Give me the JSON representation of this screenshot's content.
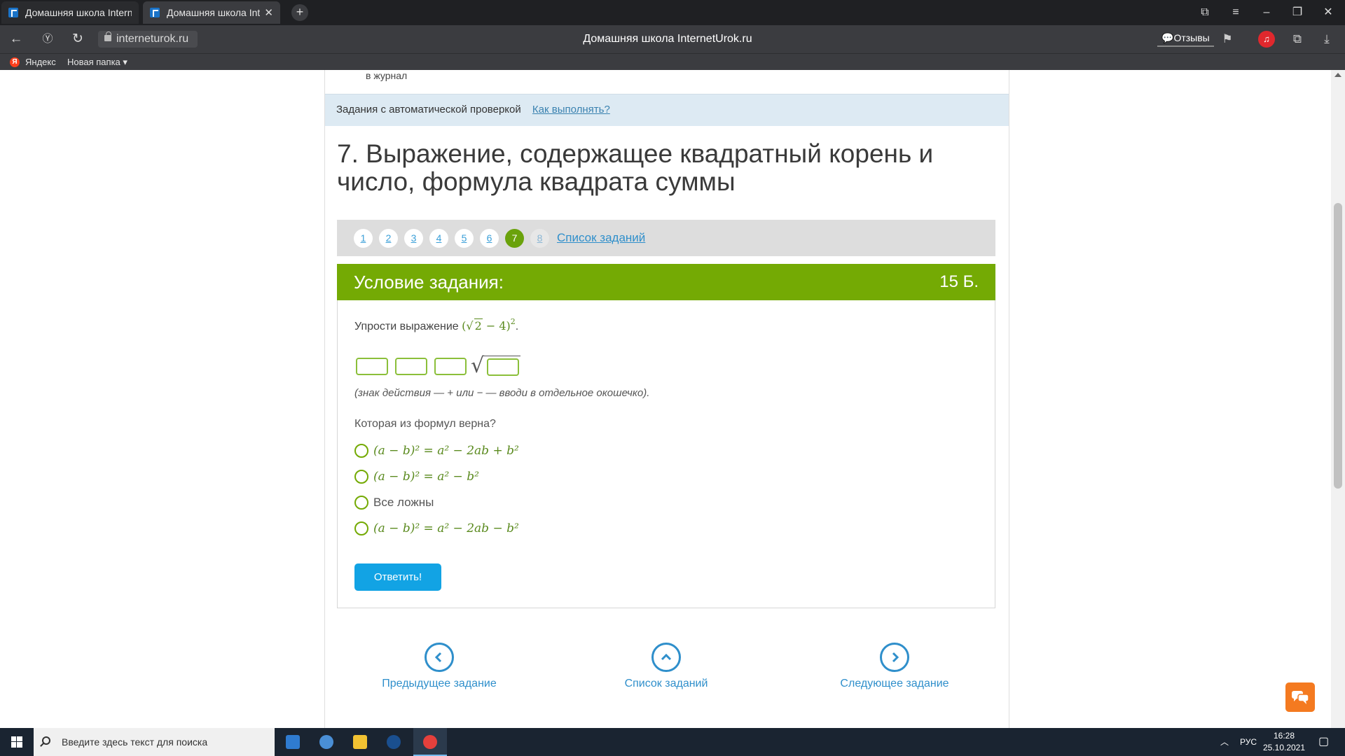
{
  "browser": {
    "tabs": [
      {
        "title": "Домашняя школа InternetUrok.ru"
      },
      {
        "title": "Домашняя школа InternetUrok.ru"
      }
    ],
    "url": "interneturok.ru",
    "page_title": "Домашняя школа InternetUrok.ru",
    "reviews_label": "Отзывы",
    "bookmarks": [
      {
        "label": "Яндекс"
      },
      {
        "label": "Новая папка ▾"
      }
    ]
  },
  "page": {
    "journal_text": "в журнал",
    "auto_check_label": "Задания с автоматической проверкой",
    "howto_link": "Как выполнять?",
    "task_title": "7. Выражение, содержащее квадратный корень и число, формула квадрата суммы",
    "pager": {
      "pages": [
        "1",
        "2",
        "3",
        "4",
        "5",
        "6",
        "7",
        "8"
      ],
      "active": "7",
      "list_link": "Список заданий"
    },
    "task": {
      "header_title": "Условие задания:",
      "points": "15 Б.",
      "prompt_text": "Упрости выражение",
      "hint": "(знак действия — + или − — вводи в отдельное окошечко).",
      "question": "Которая из формул верна?",
      "options": [
        {
          "label": "(a − b)² = a² − 2ab + b²"
        },
        {
          "label": "(a − b)² = a² − b²"
        },
        {
          "label": "Все ложны"
        },
        {
          "label": "(a − b)² = a² − 2ab − b²"
        }
      ],
      "submit_label": "Ответить!"
    },
    "bottom_nav": {
      "prev": "Предыдущее задание",
      "list": "Список заданий",
      "next": "Следующее задание"
    }
  },
  "taskbar": {
    "search_placeholder": "Введите здесь текст для поиска",
    "language": "РУС",
    "time": "16:28",
    "date": "25.10.2021"
  },
  "colors": {
    "accent_green": "#74aa04",
    "link_blue": "#2f8fcb",
    "button_blue": "#12a3e4",
    "chat_orange": "#f47a20"
  }
}
